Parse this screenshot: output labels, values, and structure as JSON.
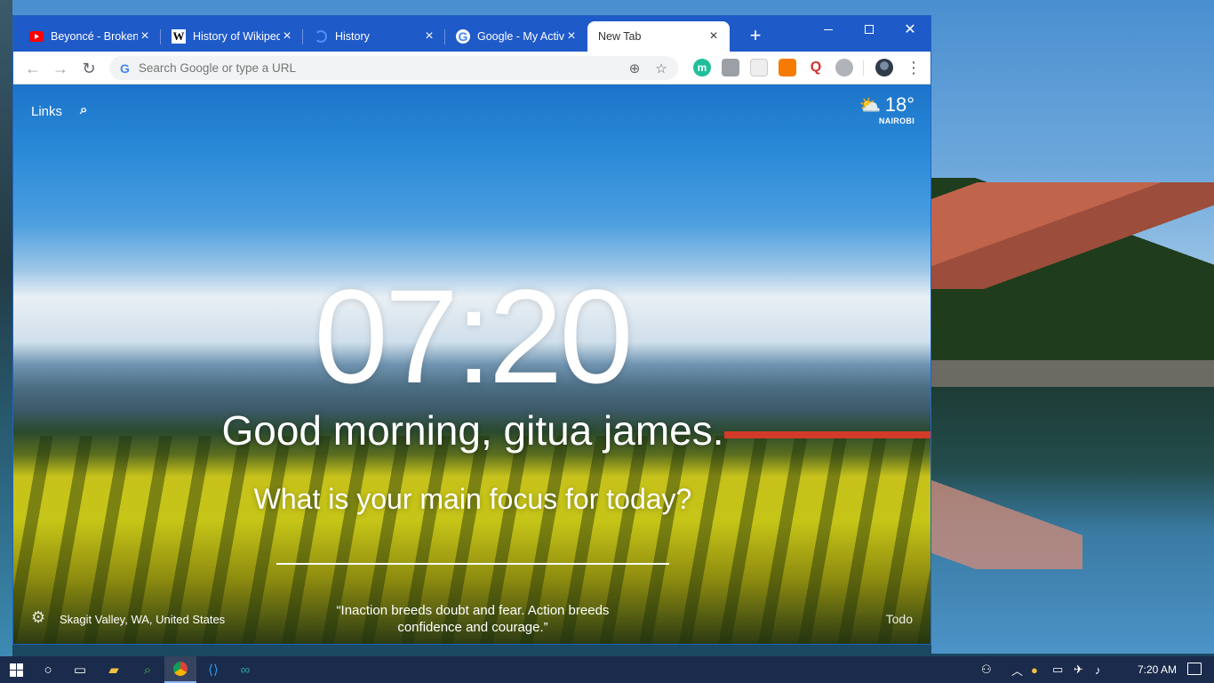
{
  "tabs": [
    {
      "title": "Beyoncé - Broken-Hearted Girl",
      "favicon": "youtube-icon",
      "active": false
    },
    {
      "title": "History of Wikipedia",
      "favicon": "wikipedia-icon",
      "active": false
    },
    {
      "title": "History",
      "favicon": "history-icon",
      "active": false
    },
    {
      "title": "Google - My Activity",
      "favicon": "google-icon",
      "active": false
    },
    {
      "title": "New Tab",
      "favicon": "",
      "active": true
    }
  ],
  "toolbar": {
    "omnibox_placeholder": "Search Google or type a URL"
  },
  "page": {
    "links_label": "Links",
    "weather_temp": "18°",
    "weather_city": "NAIROBI",
    "clock": "07:20",
    "greeting": "Good morning, gitua james.",
    "focus_question": "What is your main focus for today?",
    "location": "Skagit Valley, WA, United States",
    "quote": "“Inaction breeds doubt and fear. Action breeds confidence and courage.”",
    "todo_label": "Todo"
  },
  "taskbar": {
    "time": "7:20 AM"
  },
  "colors": {
    "titlebar": "#1f5ac9",
    "taskbar": "#1b2b4b"
  }
}
